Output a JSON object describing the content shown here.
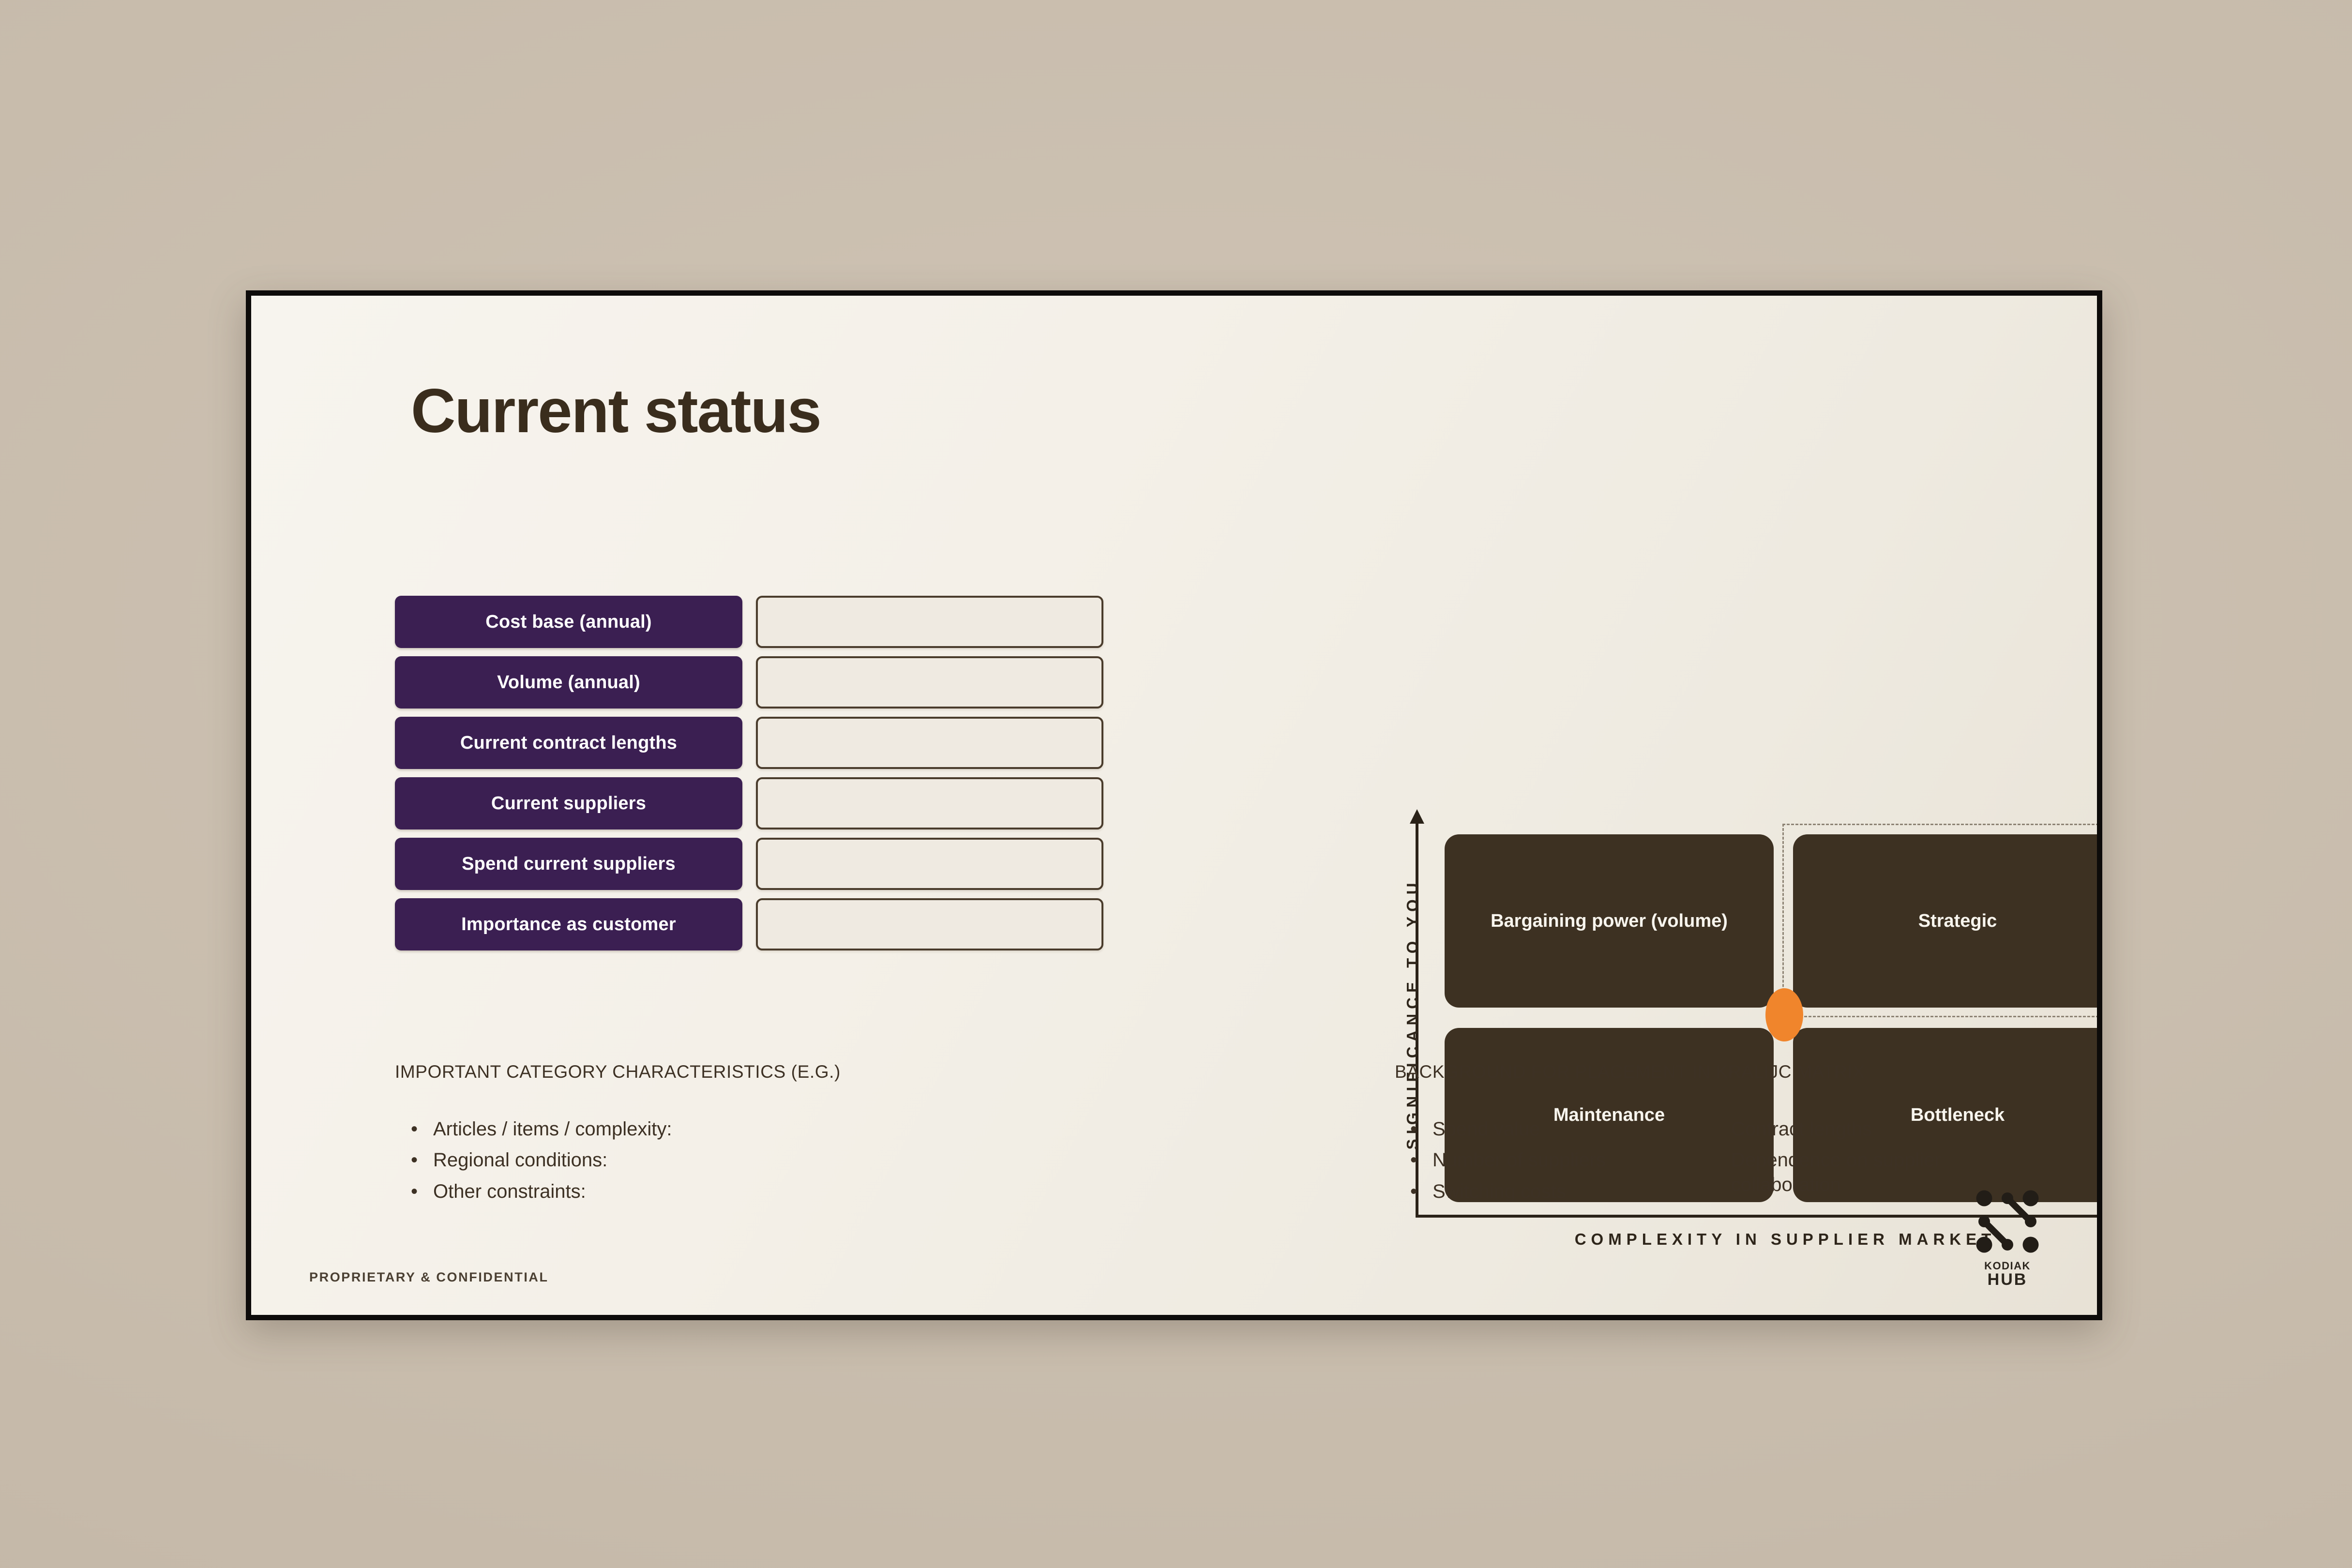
{
  "slide": {
    "title": "Current status",
    "footer_note": "PROPRIETARY & CONFIDENTIAL"
  },
  "form": {
    "rows": [
      {
        "label": "Cost base (annual)",
        "value": ""
      },
      {
        "label": "Volume (annual)",
        "value": ""
      },
      {
        "label": "Current contract lengths",
        "value": ""
      },
      {
        "label": "Current suppliers",
        "value": ""
      },
      {
        "label": "Spend current suppliers",
        "value": ""
      },
      {
        "label": "Importance as customer",
        "value": ""
      }
    ]
  },
  "matrix": {
    "y_axis_label": "SIGNIFICANCE TO YOU",
    "x_axis_label": "COMPLEXITY IN SUPPLIER MARKET",
    "quadrants": {
      "top_left": "Bargaining power (volume)",
      "top_right": "Strategic",
      "bottom_left": "Maintenance",
      "bottom_right": "Bottleneck"
    },
    "selected_quadrant": "Strategic",
    "marker_color": "#f0852c",
    "quadrant_color": "#3d3122"
  },
  "sections": {
    "left_heading": "IMPORTANT CATEGORY CHARACTERISTICS (E.G.)",
    "right_heading": "BACKGROUND FOR PLACEMENT IN KRALIJC MATRIX",
    "left_bullets": [
      "Articles / items / complexity:",
      "Regional conditions:",
      "Other constraints:"
    ],
    "right_bullets_col1": [
      "Spend value",
      "Number of suppliers",
      "Switching costs"
    ],
    "right_bullets_col2": [
      "Contract lengths",
      "Dependence on supplier collaboration"
    ],
    "bullet_glyph": "•"
  },
  "brand": {
    "name_top": "KODIAK",
    "name_bottom": "HUB"
  },
  "colors": {
    "accent_orange": "#f0852c",
    "label_purple": "#3b1f52",
    "quadrant_brown": "#3d3122",
    "slide_bg": "#f4f0e9",
    "page_bg": "#c9bdae"
  }
}
